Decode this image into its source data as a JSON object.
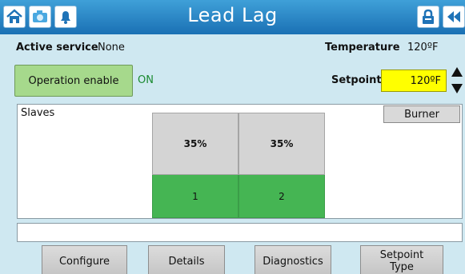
{
  "header": {
    "title": "Lead Lag",
    "icons": [
      "home-icon",
      "camera-icon",
      "alarm-bell-icon",
      "lock-icon",
      "back-icon"
    ]
  },
  "status": {
    "active_service_label": "Active service",
    "active_service_value": "None",
    "temperature_label": "Temperature",
    "temperature_value": "120ºF"
  },
  "operation": {
    "button_label": "Operation enable",
    "state": "ON"
  },
  "setpoint": {
    "label": "Setpoint",
    "value": "120ºF"
  },
  "slaves": {
    "label": "Slaves",
    "burner_button": "Burner",
    "items": [
      {
        "percent": "35%",
        "number": "1"
      },
      {
        "percent": "35%",
        "number": "2"
      }
    ]
  },
  "status_line": "",
  "bottom_buttons": {
    "configure": "Configure",
    "details": "Details",
    "diagnostics": "Diagnostics",
    "setpoint_type_line1": "Setpoint",
    "setpoint_type_line2": "Type"
  },
  "colors": {
    "title_bar": "#2a86c7",
    "background": "#cfe8f1",
    "operation_button": "#a6d98c",
    "on_text": "#1a8a30",
    "setpoint_field": "#ffff00",
    "slave_active": "#45b553",
    "slave_percent_bg": "#d4d4d4"
  }
}
